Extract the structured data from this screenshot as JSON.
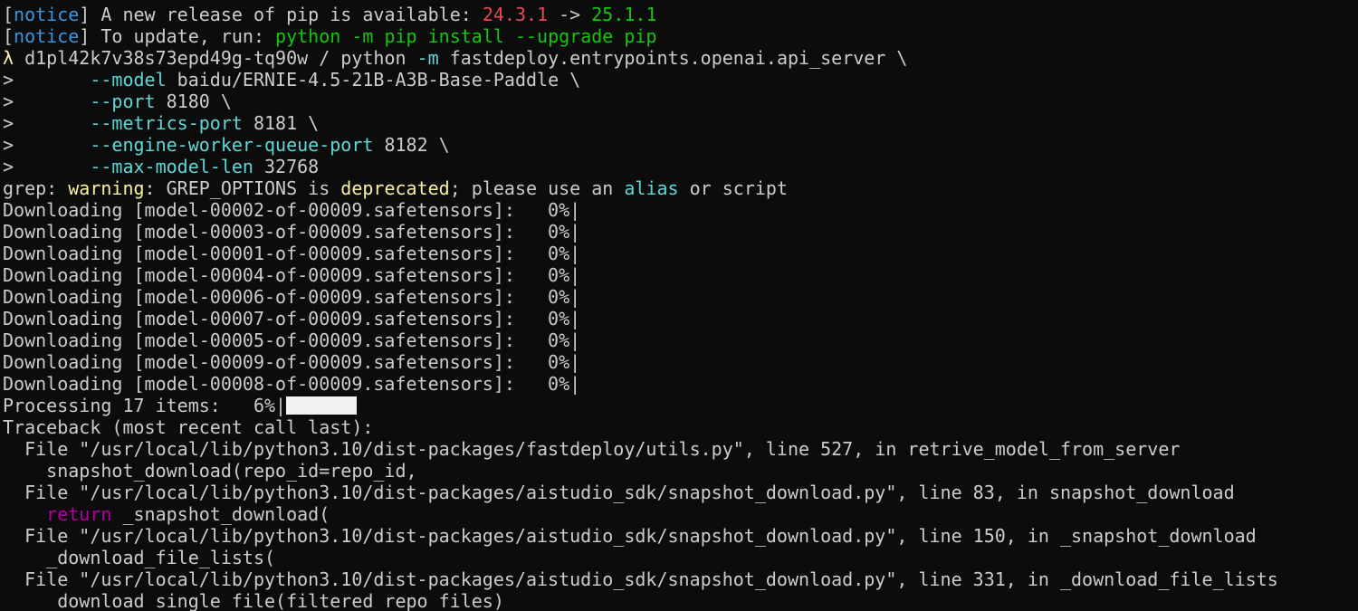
{
  "terminal": {
    "notice1": {
      "tag": "notice",
      "text": " A new release of pip is available: ",
      "old_version": "24.3.1",
      "arrow": " -> ",
      "new_version": "25.1.1"
    },
    "notice2": {
      "tag": "notice",
      "text": " To update, run: ",
      "command": "python -m pip install --upgrade pip"
    },
    "prompt": {
      "symbol": "λ",
      "host": " d1pl42k7v38s73epd49g-tq90w",
      "path": " /",
      "command": " python",
      "flag_m": " -m",
      "module": " fastdeploy.entrypoints.openai.api_server \\"
    },
    "continuations": [
      {
        "prefix": ">",
        "indent": "       ",
        "flag": "--model",
        "value": " baidu/ERNIE-4.5-21B-A3B-Base-Paddle \\"
      },
      {
        "prefix": ">",
        "indent": "       ",
        "flag": "--port",
        "value": " 8180 \\"
      },
      {
        "prefix": ">",
        "indent": "       ",
        "flag": "--metrics-port",
        "value": " 8181 \\"
      },
      {
        "prefix": ">",
        "indent": "       ",
        "flag": "--engine-worker-queue-port",
        "value": " 8182 \\"
      },
      {
        "prefix": ">",
        "indent": "       ",
        "flag": "--max-model-len",
        "value": " 32768"
      }
    ],
    "grep_warning": {
      "p1": "grep: ",
      "p2": "warning",
      "p3": ": GREP_OPTIONS is ",
      "p4": "deprecated",
      "p5": "; please use an ",
      "p6": "alias",
      "p7": " or script"
    },
    "downloads": [
      "Downloading [model-00002-of-00009.safetensors]:   0%|",
      "Downloading [model-00003-of-00009.safetensors]:   0%|",
      "Downloading [model-00001-of-00009.safetensors]:   0%|",
      "Downloading [model-00004-of-00009.safetensors]:   0%|",
      "Downloading [model-00006-of-00009.safetensors]:   0%|",
      "Downloading [model-00007-of-00009.safetensors]:   0%|",
      "Downloading [model-00005-of-00009.safetensors]:   0%|",
      "Downloading [model-00009-of-00009.safetensors]:   0%|",
      "Downloading [model-00008-of-00009.safetensors]:   0%|"
    ],
    "processing": {
      "text": "Processing 17 items:   6%|",
      "progress_fraction": 0.06
    },
    "traceback": {
      "header": "Traceback (most recent call last):",
      "frames": [
        {
          "file_line": "  File \"/usr/local/lib/python3.10/dist-packages/fastdeploy/utils.py\", line 527, in retrive_model_from_server",
          "code_keyword": "",
          "code": "    snapshot_download(repo_id=repo_id,"
        },
        {
          "file_line": "  File \"/usr/local/lib/python3.10/dist-packages/aistudio_sdk/snapshot_download.py\", line 83, in snapshot_download",
          "code_keyword": "    return",
          "code": " _snapshot_download("
        },
        {
          "file_line": "  File \"/usr/local/lib/python3.10/dist-packages/aistudio_sdk/snapshot_download.py\", line 150, in _snapshot_download",
          "code_keyword": "",
          "code": "    _download_file_lists("
        },
        {
          "file_line": "  File \"/usr/local/lib/python3.10/dist-packages/aistudio_sdk/snapshot_download.py\", line 331, in _download_file_lists",
          "code_keyword": "",
          "code": "    _download_single_file(filtered_repo_files)"
        }
      ]
    },
    "colors": {
      "background": "#0c0c0c",
      "foreground": "#cccccc",
      "notice": "#3a96dd",
      "old_version": "#e74856",
      "new_version": "#16c60c",
      "prompt_symbol": "#f9f1a5",
      "flag": "#61d6d6",
      "keyword": "#b4009e"
    }
  }
}
